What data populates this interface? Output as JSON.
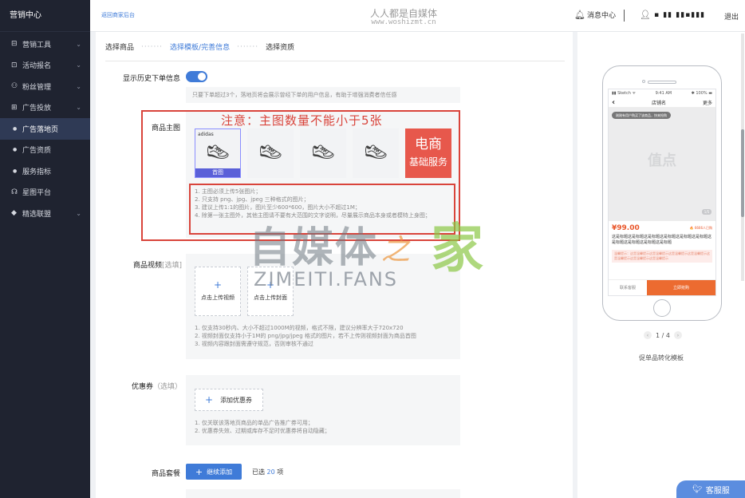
{
  "sidebar": {
    "brand": "营销中心",
    "items": [
      {
        "label": "营销工具",
        "icon": "gift-icon",
        "glyph": "⊟",
        "expandable": true
      },
      {
        "label": "活动报名",
        "icon": "calendar-icon",
        "glyph": "⊡",
        "expandable": true
      },
      {
        "label": "粉丝管理",
        "icon": "fans-icon",
        "glyph": "⚇",
        "expandable": true
      },
      {
        "label": "广告投放",
        "icon": "ad-icon",
        "glyph": "⊞",
        "expandable": true
      },
      {
        "label": "广告落地页",
        "icon": "dot-icon",
        "glyph": "●",
        "active": true
      },
      {
        "label": "广告资质",
        "icon": "dot-icon",
        "glyph": "●"
      },
      {
        "label": "服务指标",
        "icon": "dot-icon",
        "glyph": "●"
      },
      {
        "label": "星图平台",
        "icon": "star-platform-icon",
        "glyph": "☊"
      },
      {
        "label": "精选联盟",
        "icon": "diamond-icon",
        "glyph": "◆",
        "expandable": true
      }
    ]
  },
  "header": {
    "back_link": "返回商家后台",
    "watermark_title": "人人都是自媒体",
    "watermark_url": "www.woshizmt.cn",
    "message_center": "消息中心",
    "user_name": "▪ ▮▮ ▮▮▪▮▮▮",
    "logout": "退出"
  },
  "steps": [
    "选择商品",
    "选择模板/完善信息",
    "选择资质"
  ],
  "steps_dots": "·······",
  "history": {
    "label": "显示历史下单信息",
    "enabled": true,
    "note": "只要下单超过3个，落地页将会展示曾经下单的用户信息，有助于增强消费者信任感"
  },
  "main_image": {
    "label": "商品主图",
    "annotation": "注意：主图数量不能小于5张",
    "cover_tag": "首图",
    "brand_mark": "adidas",
    "badge_line1": "电商",
    "badge_line2": "基础服务",
    "rules": [
      "1. 主图必须上传5张图片；",
      "2. 只支持 png、jpg、jpeg 三种格式的图片；",
      "3. 建议上传1:1的图片，图片至少600*600，图片大小不超过1M；",
      "4. 除第一张主图外，其他主图请不要有大范围的文字说明，尽量展示商品本身或者模特上身图；"
    ]
  },
  "video": {
    "label": "商品视频",
    "optional": "[选填]",
    "upload_video": "点击上传视频",
    "upload_cover": "点击上传封面",
    "rules": [
      "1. 仅支持30秒内、大小不超过1000M的视频，格式不限，建议分辨率大于720x720",
      "2. 视频封面仅支持小于1M的 png/jpg/jpeg 格式的图片，若不上传则视频封面为商品首图",
      "3. 视频内容跟封面需遵守规范，否则审核不通过"
    ]
  },
  "coupon": {
    "label": "优惠券",
    "optional": "（选填）",
    "add_button": "添加优惠券",
    "rules": [
      "1. 仅关联该落地页商品的单品广告推广券可用；",
      "2. 优惠券失效、过期或库存不足时优惠券将自动隐藏；"
    ]
  },
  "package": {
    "label": "商品套餐",
    "add_button": "继续添加",
    "selected_prefix": "已选",
    "selected_count": "20",
    "selected_suffix": "项"
  },
  "watermark": {
    "big": "自媒体",
    "zhi": "之",
    "jia": "家",
    "en": "ZIMEITI.FANS"
  },
  "preview": {
    "status_left": "▮▮ Sketch ᯤ",
    "status_mid": "9:41 AM",
    "status_right": "✱ 100% ▬",
    "shop_name": "店铺名",
    "more": "更多",
    "back_glyph": "‹",
    "pill_text": "刚刚有用户购买了该商品，快来抢购",
    "placeholder": "值点",
    "page_tag": "1/5",
    "price": "¥99.00",
    "sold": "🔥 6666人已购",
    "title": "这是标题这是标题这是标题这是标题这是标题这是标题这是标题这是标题这是标题这是标题",
    "warn": "温馨提示：这是温馨提示这是温馨提示这是温馨提示这是温馨提示这是温馨提示这是温馨提示这是温馨提示",
    "cs_label": "联系客服",
    "buy_label": "立即抢购",
    "pager": "1 / 4",
    "template_name": "促单品转化模板"
  },
  "customer_service": "客服服"
}
